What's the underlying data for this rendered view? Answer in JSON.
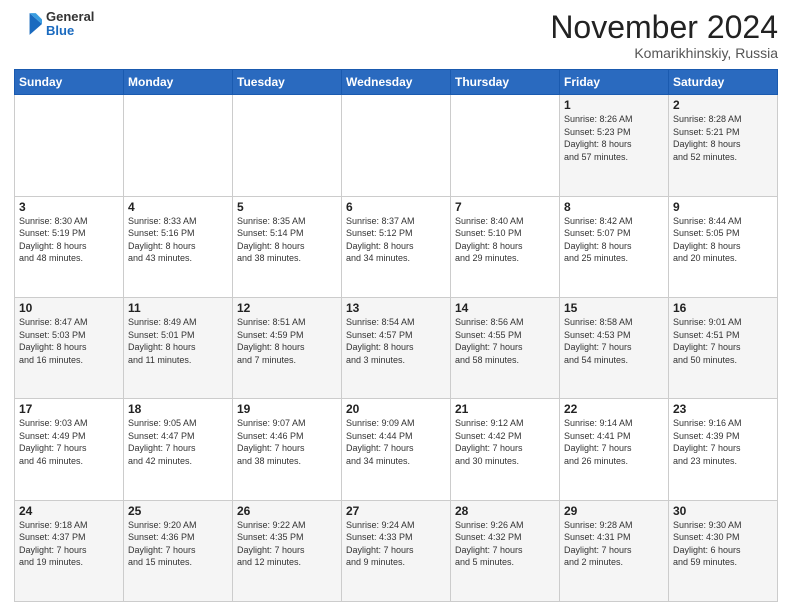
{
  "header": {
    "logo": {
      "general": "General",
      "blue": "Blue"
    },
    "title": "November 2024",
    "location": "Komarikhinskiy, Russia"
  },
  "weekdays": [
    "Sunday",
    "Monday",
    "Tuesday",
    "Wednesday",
    "Thursday",
    "Friday",
    "Saturday"
  ],
  "weeks": [
    [
      {
        "day": "",
        "info": ""
      },
      {
        "day": "",
        "info": ""
      },
      {
        "day": "",
        "info": ""
      },
      {
        "day": "",
        "info": ""
      },
      {
        "day": "",
        "info": ""
      },
      {
        "day": "1",
        "info": "Sunrise: 8:26 AM\nSunset: 5:23 PM\nDaylight: 8 hours\nand 57 minutes."
      },
      {
        "day": "2",
        "info": "Sunrise: 8:28 AM\nSunset: 5:21 PM\nDaylight: 8 hours\nand 52 minutes."
      }
    ],
    [
      {
        "day": "3",
        "info": "Sunrise: 8:30 AM\nSunset: 5:19 PM\nDaylight: 8 hours\nand 48 minutes."
      },
      {
        "day": "4",
        "info": "Sunrise: 8:33 AM\nSunset: 5:16 PM\nDaylight: 8 hours\nand 43 minutes."
      },
      {
        "day": "5",
        "info": "Sunrise: 8:35 AM\nSunset: 5:14 PM\nDaylight: 8 hours\nand 38 minutes."
      },
      {
        "day": "6",
        "info": "Sunrise: 8:37 AM\nSunset: 5:12 PM\nDaylight: 8 hours\nand 34 minutes."
      },
      {
        "day": "7",
        "info": "Sunrise: 8:40 AM\nSunset: 5:10 PM\nDaylight: 8 hours\nand 29 minutes."
      },
      {
        "day": "8",
        "info": "Sunrise: 8:42 AM\nSunset: 5:07 PM\nDaylight: 8 hours\nand 25 minutes."
      },
      {
        "day": "9",
        "info": "Sunrise: 8:44 AM\nSunset: 5:05 PM\nDaylight: 8 hours\nand 20 minutes."
      }
    ],
    [
      {
        "day": "10",
        "info": "Sunrise: 8:47 AM\nSunset: 5:03 PM\nDaylight: 8 hours\nand 16 minutes."
      },
      {
        "day": "11",
        "info": "Sunrise: 8:49 AM\nSunset: 5:01 PM\nDaylight: 8 hours\nand 11 minutes."
      },
      {
        "day": "12",
        "info": "Sunrise: 8:51 AM\nSunset: 4:59 PM\nDaylight: 8 hours\nand 7 minutes."
      },
      {
        "day": "13",
        "info": "Sunrise: 8:54 AM\nSunset: 4:57 PM\nDaylight: 8 hours\nand 3 minutes."
      },
      {
        "day": "14",
        "info": "Sunrise: 8:56 AM\nSunset: 4:55 PM\nDaylight: 7 hours\nand 58 minutes."
      },
      {
        "day": "15",
        "info": "Sunrise: 8:58 AM\nSunset: 4:53 PM\nDaylight: 7 hours\nand 54 minutes."
      },
      {
        "day": "16",
        "info": "Sunrise: 9:01 AM\nSunset: 4:51 PM\nDaylight: 7 hours\nand 50 minutes."
      }
    ],
    [
      {
        "day": "17",
        "info": "Sunrise: 9:03 AM\nSunset: 4:49 PM\nDaylight: 7 hours\nand 46 minutes."
      },
      {
        "day": "18",
        "info": "Sunrise: 9:05 AM\nSunset: 4:47 PM\nDaylight: 7 hours\nand 42 minutes."
      },
      {
        "day": "19",
        "info": "Sunrise: 9:07 AM\nSunset: 4:46 PM\nDaylight: 7 hours\nand 38 minutes."
      },
      {
        "day": "20",
        "info": "Sunrise: 9:09 AM\nSunset: 4:44 PM\nDaylight: 7 hours\nand 34 minutes."
      },
      {
        "day": "21",
        "info": "Sunrise: 9:12 AM\nSunset: 4:42 PM\nDaylight: 7 hours\nand 30 minutes."
      },
      {
        "day": "22",
        "info": "Sunrise: 9:14 AM\nSunset: 4:41 PM\nDaylight: 7 hours\nand 26 minutes."
      },
      {
        "day": "23",
        "info": "Sunrise: 9:16 AM\nSunset: 4:39 PM\nDaylight: 7 hours\nand 23 minutes."
      }
    ],
    [
      {
        "day": "24",
        "info": "Sunrise: 9:18 AM\nSunset: 4:37 PM\nDaylight: 7 hours\nand 19 minutes."
      },
      {
        "day": "25",
        "info": "Sunrise: 9:20 AM\nSunset: 4:36 PM\nDaylight: 7 hours\nand 15 minutes."
      },
      {
        "day": "26",
        "info": "Sunrise: 9:22 AM\nSunset: 4:35 PM\nDaylight: 7 hours\nand 12 minutes."
      },
      {
        "day": "27",
        "info": "Sunrise: 9:24 AM\nSunset: 4:33 PM\nDaylight: 7 hours\nand 9 minutes."
      },
      {
        "day": "28",
        "info": "Sunrise: 9:26 AM\nSunset: 4:32 PM\nDaylight: 7 hours\nand 5 minutes."
      },
      {
        "day": "29",
        "info": "Sunrise: 9:28 AM\nSunset: 4:31 PM\nDaylight: 7 hours\nand 2 minutes."
      },
      {
        "day": "30",
        "info": "Sunrise: 9:30 AM\nSunset: 4:30 PM\nDaylight: 6 hours\nand 59 minutes."
      }
    ]
  ]
}
